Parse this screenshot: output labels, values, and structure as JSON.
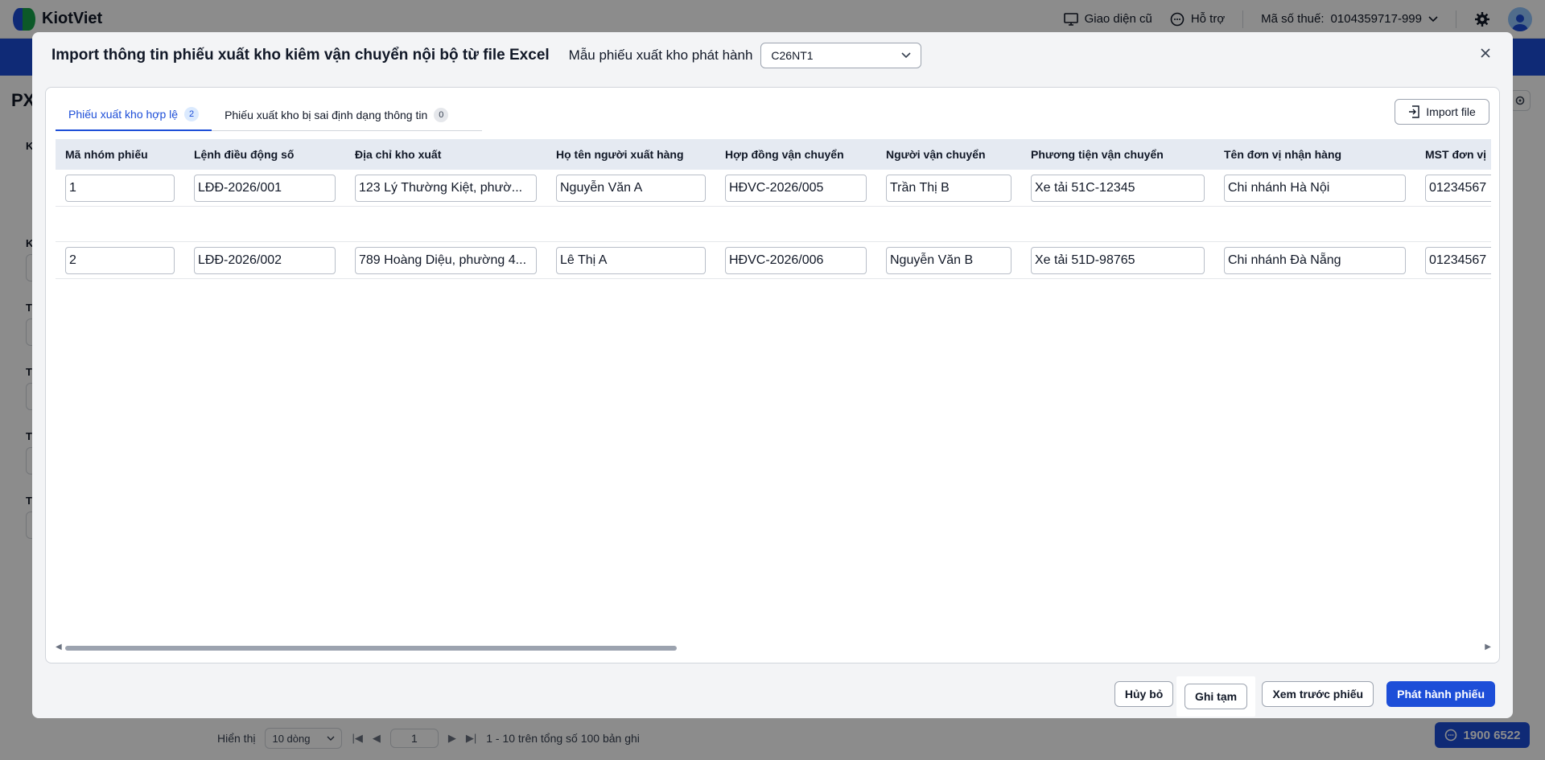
{
  "app": {
    "name": "KiotViet"
  },
  "topbar": {
    "legacy_ui_label": "Giao diện cũ",
    "support_label": "Hỗ trợ",
    "tax_label": "Mã số thuế:",
    "tax_value": "0104359717-999"
  },
  "background": {
    "page_title": "PX",
    "side_labels": [
      "K",
      "K",
      "T",
      "T",
      "T",
      "T"
    ],
    "footer": {
      "show_label": "Hiển thị",
      "rows_option": "10 dòng",
      "page_value": "1",
      "range_text": "1 - 10 trên tổng số 100 bản ghi"
    },
    "hotline": "1900 6522"
  },
  "modal": {
    "title": "Import thông tin phiếu xuất kho kiêm vận chuyển nội bộ từ file Excel",
    "template_label": "Mẫu phiếu xuất kho phát hành",
    "template_value": "C26NT1",
    "tabs": [
      {
        "label": "Phiếu xuất kho hợp lệ",
        "count": "2"
      },
      {
        "label": "Phiếu xuất kho bị sai định dạng thông tin",
        "count": "0"
      }
    ],
    "import_label": "Import file",
    "columns": [
      "Mã nhóm phiếu",
      "Lệnh điều động số",
      "Địa chỉ kho xuất",
      "Họ tên người xuất hàng",
      "Hợp đồng vận chuyển",
      "Người vận chuyển",
      "Phương tiện vận chuyển",
      "Tên đơn vị nhận hàng",
      "MST đơn vị"
    ],
    "rows": [
      [
        "1",
        "LĐĐ-2026/001",
        "123 Lý Thường Kiệt, phườ...",
        "Nguyễn Văn A",
        "HĐVC-2026/005",
        "Trần Thị B",
        "Xe tải 51C-12345",
        "Chi nhánh Hà Nội",
        "01234567"
      ],
      [
        "2",
        "LĐĐ-2026/002",
        "789 Hoàng Diệu, phường 4...",
        "Lê Thị A",
        "HĐVC-2026/006",
        "Nguyễn Văn B",
        "Xe tải 51D-98765",
        "Chi nhánh Đà Nẵng",
        "01234567"
      ]
    ],
    "buttons": {
      "cancel": "Hủy bỏ",
      "save_draft": "Ghi tạm",
      "preview": "Xem trước phiếu",
      "issue": "Phát hành phiếu"
    }
  },
  "colors": {
    "primary": "#1d4ed8",
    "header_bg": "#e5eaf2",
    "overlay": "rgba(0,0,0,0.45)"
  }
}
